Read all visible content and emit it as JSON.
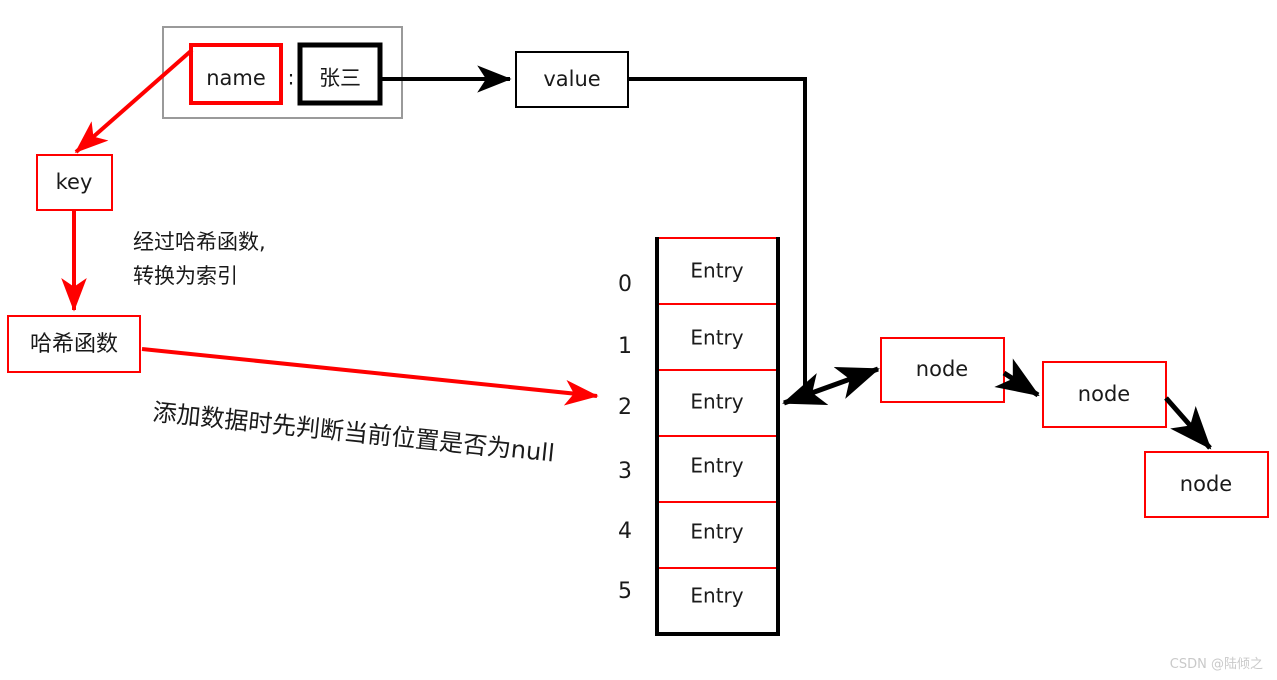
{
  "diagram": {
    "title": "HashMap put flow diagram",
    "colors": {
      "red": "#ff0000",
      "black": "#000000",
      "gray_frame": "#9a9a9a",
      "text": "#1a1a1a",
      "watermark": "#c9c9c9",
      "background": "#ffffff"
    },
    "pair_group": {
      "key_box_label": "name",
      "separator": ":",
      "value_box_label": "张三"
    },
    "value_box": {
      "label": "value"
    },
    "key_box": {
      "label": "key"
    },
    "hash_box": {
      "label": "哈希函数"
    },
    "notes": {
      "hash_note_line1": "经过哈希函数,",
      "hash_note_line2": "转换为索引",
      "null_check_note": "添加数据时先判断当前位置是否为null"
    },
    "table": {
      "indices": [
        "0",
        "1",
        "2",
        "3",
        "4",
        "5"
      ],
      "cells": [
        "Entry",
        "Entry",
        "Entry",
        "Entry",
        "Entry",
        "Entry"
      ]
    },
    "nodes": [
      {
        "label": "node"
      },
      {
        "label": "node"
      },
      {
        "label": "node"
      }
    ]
  },
  "watermark": {
    "text": "CSDN @陆倾之"
  }
}
